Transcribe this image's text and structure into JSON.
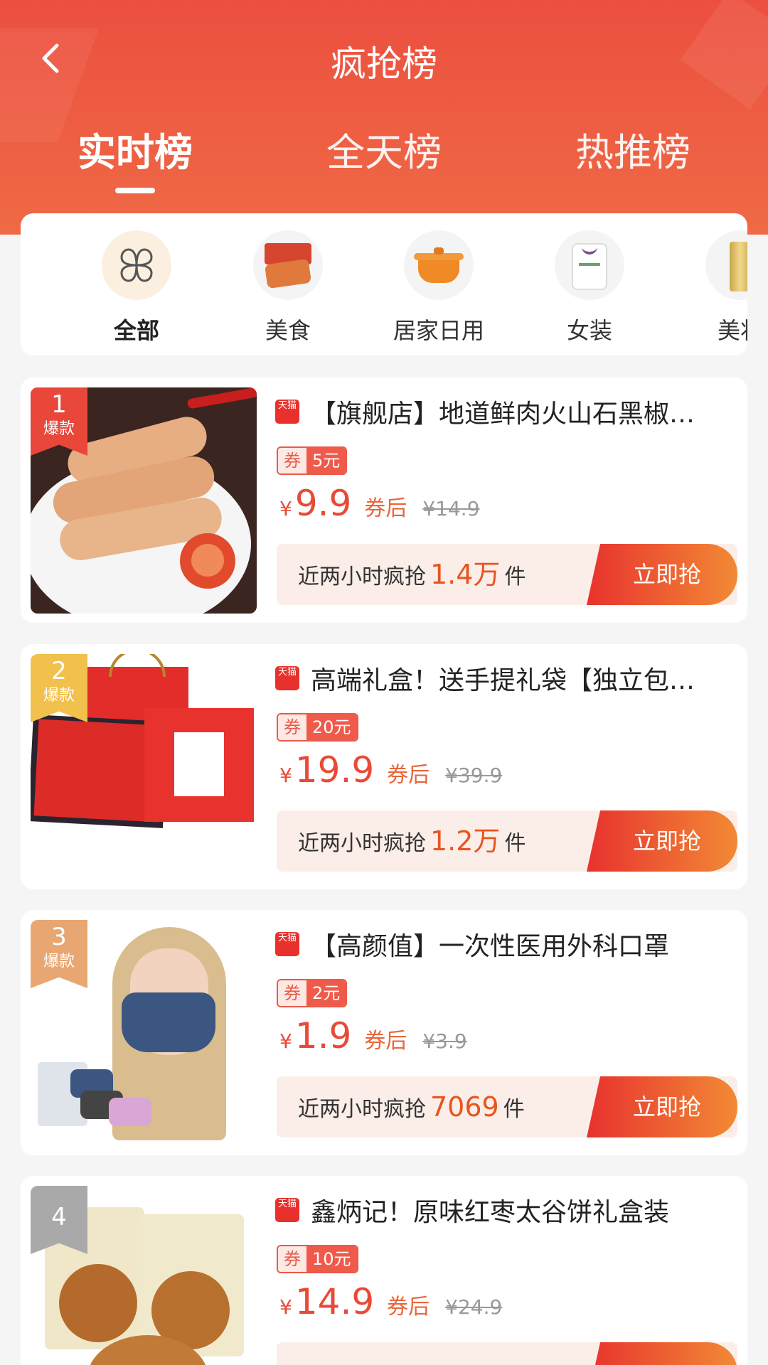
{
  "header": {
    "title": "疯抢榜",
    "tabs": [
      "实时榜",
      "全天榜",
      "热推榜"
    ]
  },
  "categories": [
    {
      "label": "全部",
      "icon": "grid-icon"
    },
    {
      "label": "美食",
      "icon": "food-icon"
    },
    {
      "label": "居家日用",
      "icon": "pot-icon"
    },
    {
      "label": "女装",
      "icon": "sweater-icon"
    },
    {
      "label": "美妆",
      "icon": "bottle-icon"
    }
  ],
  "products": [
    {
      "rank": "1",
      "rank_tag": "爆款",
      "store_badge": "天猫",
      "title": "【旗舰店】地道鲜肉火山石黑椒…",
      "coupon_label": "券",
      "coupon_value": "5元",
      "yen": "¥",
      "price": "9.9",
      "after_coupon": "券后",
      "original_price": "¥14.9",
      "sale_prefix": "近两小时疯抢",
      "sale_count": "1.4万",
      "sale_unit": "件",
      "buy_label": "立即抢"
    },
    {
      "rank": "2",
      "rank_tag": "爆款",
      "store_badge": "天猫",
      "title": "高端礼盒！送手提礼袋【独立包…",
      "coupon_label": "券",
      "coupon_value": "20元",
      "yen": "¥",
      "price": "19.9",
      "after_coupon": "券后",
      "original_price": "¥39.9",
      "sale_prefix": "近两小时疯抢",
      "sale_count": "1.2万",
      "sale_unit": "件",
      "buy_label": "立即抢"
    },
    {
      "rank": "3",
      "rank_tag": "爆款",
      "store_badge": "天猫",
      "title": "【高颜值】一次性医用外科口罩",
      "coupon_label": "券",
      "coupon_value": "2元",
      "yen": "¥",
      "price": "1.9",
      "after_coupon": "券后",
      "original_price": "¥3.9",
      "sale_prefix": "近两小时疯抢",
      "sale_count": "7069",
      "sale_unit": "件",
      "buy_label": "立即抢"
    },
    {
      "rank": "4",
      "rank_tag": "",
      "store_badge": "天猫",
      "title": "鑫炳记！原味红枣太谷饼礼盒装",
      "coupon_label": "券",
      "coupon_value": "10元",
      "yen": "¥",
      "price": "14.9",
      "after_coupon": "券后",
      "original_price": "¥24.9",
      "sale_prefix": "",
      "sale_count": "",
      "sale_unit": "",
      "buy_label": ""
    }
  ],
  "colors": {
    "accent": "#e84a37",
    "header_top": "#ec4f3f",
    "header_bottom": "#ef6a45"
  }
}
